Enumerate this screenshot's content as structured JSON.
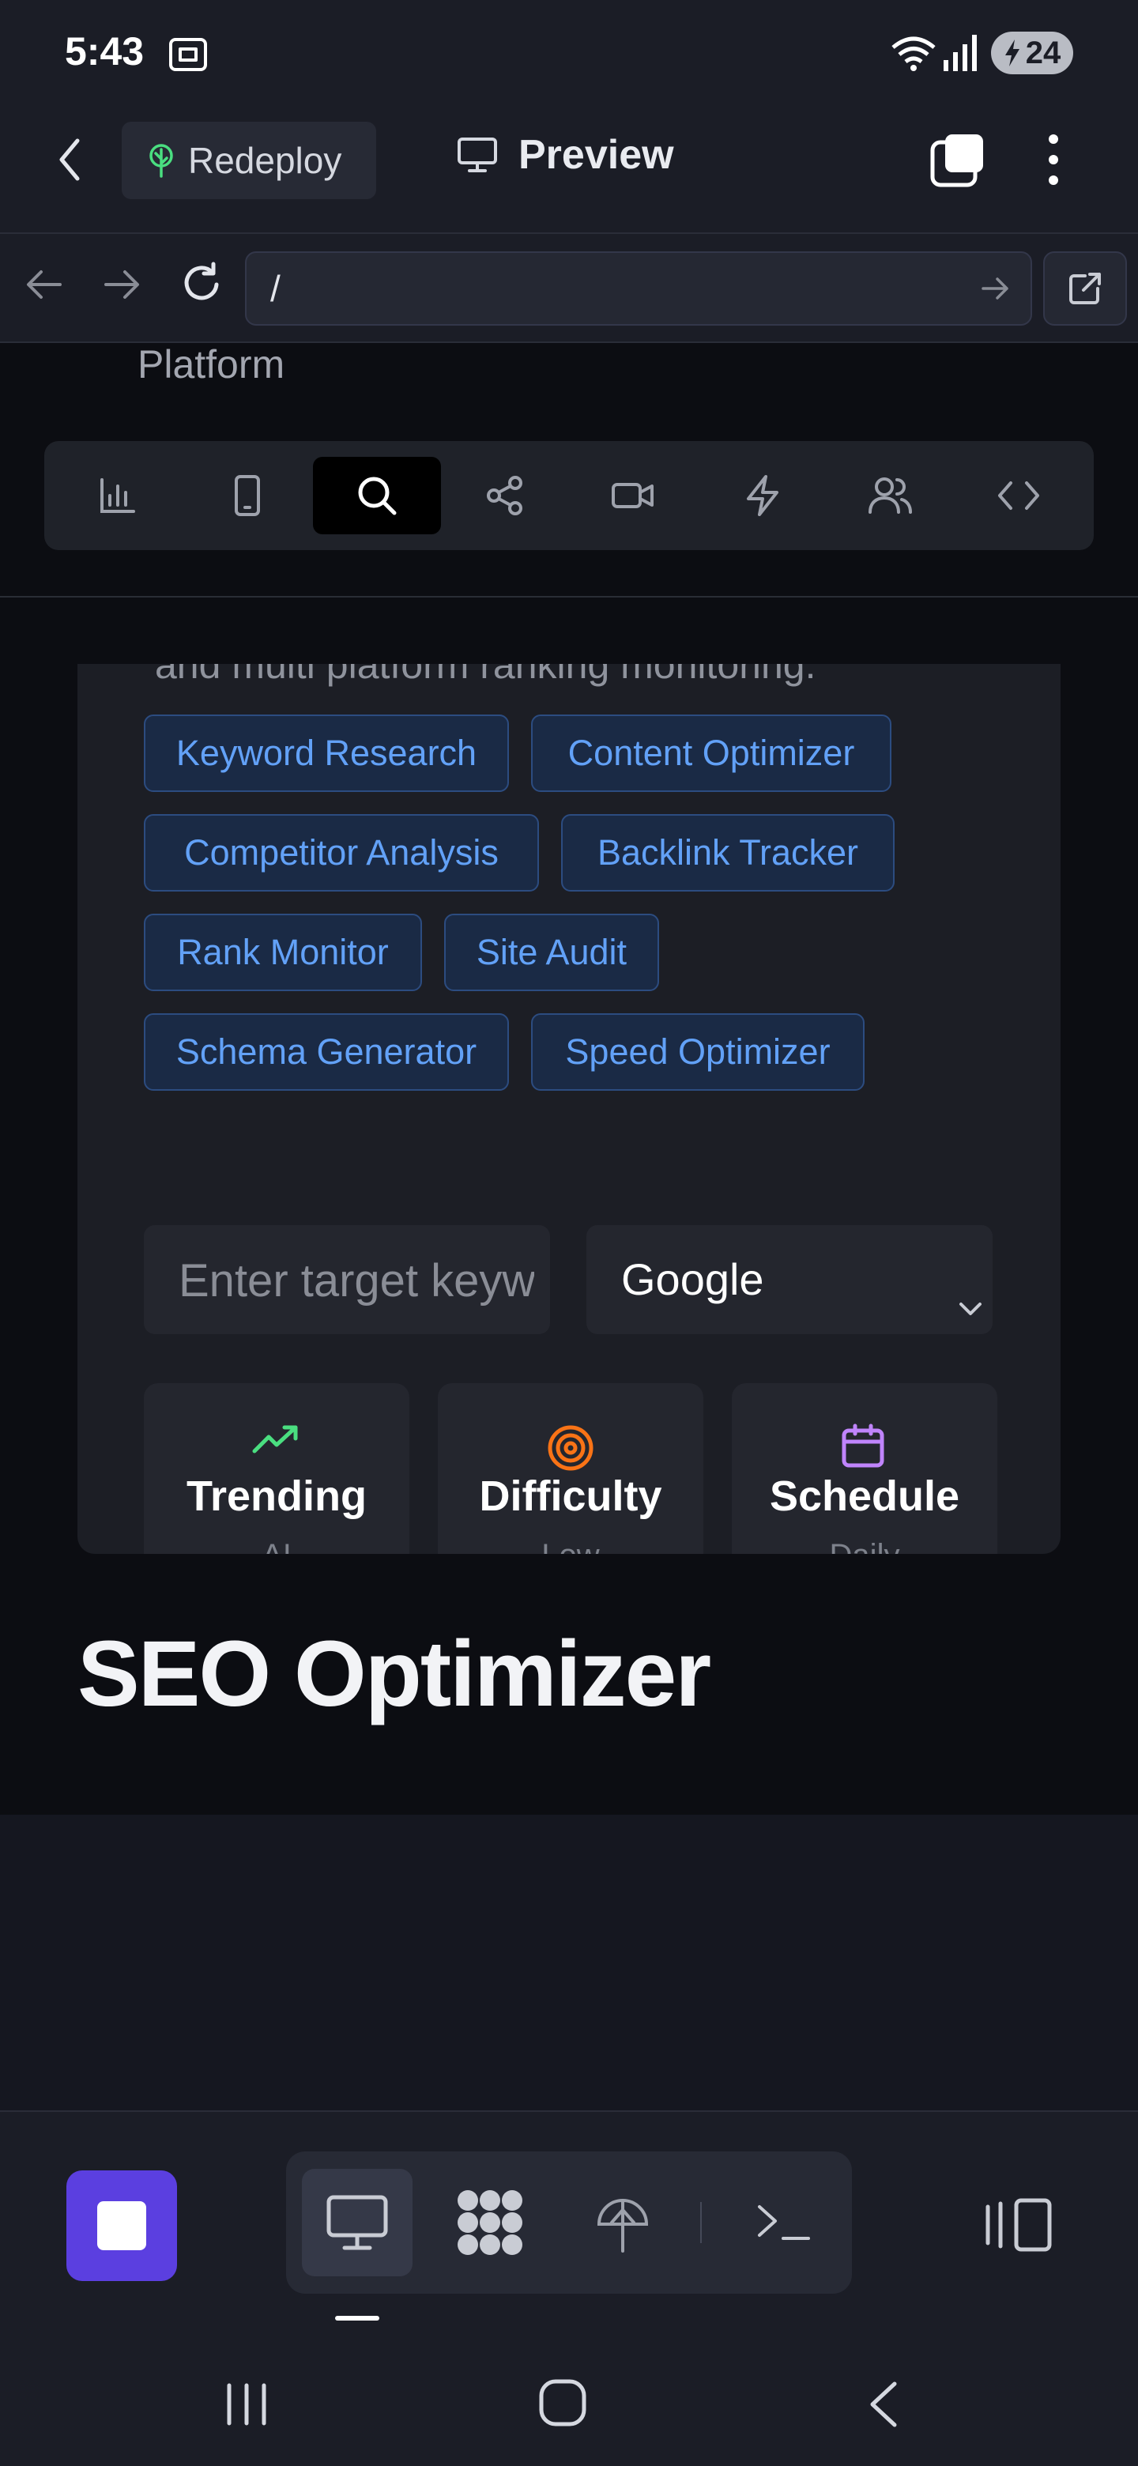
{
  "status_bar": {
    "time": "5:43",
    "battery": "24",
    "icons": [
      "screenshot-icon",
      "wifi-icon",
      "signal-icon",
      "battery-icon"
    ]
  },
  "app_bar": {
    "redeploy_label": "Redeploy",
    "preview_label": "Preview",
    "accent_color": "#4ade80"
  },
  "browser": {
    "url": "/"
  },
  "page": {
    "platform_text": "Platform",
    "toolbar_icons": [
      "analytics-icon",
      "mobile-icon",
      "search-icon",
      "share-icon",
      "video-icon",
      "zap-icon",
      "users-icon",
      "code-icon"
    ],
    "active_tool": "search-icon",
    "cut_description": "and multi platform ranking monitoring.",
    "chips": [
      "Keyword Research",
      "Content Optimizer",
      "Competitor Analysis",
      "Backlink Tracker",
      "Rank Monitor",
      "Site Audit",
      "Schema Generator",
      "Speed Optimizer"
    ],
    "keyword_placeholder": "Enter target keyword",
    "engine_selected": "Google",
    "stats": [
      {
        "label": "Trending",
        "sub": "AI",
        "color": "#4ade80"
      },
      {
        "label": "Difficulty",
        "sub": "Low",
        "color": "#f97316"
      },
      {
        "label": "Schedule",
        "sub": "Daily",
        "color": "#c084fc"
      }
    ],
    "heading": "SEO Optimizer"
  },
  "bottom_bar": {
    "stop_color": "#5b3fe0",
    "modes": [
      "desktop-icon",
      "apps-icon",
      "deploy-icon",
      "terminal-icon"
    ],
    "active_mode": "desktop-icon"
  }
}
